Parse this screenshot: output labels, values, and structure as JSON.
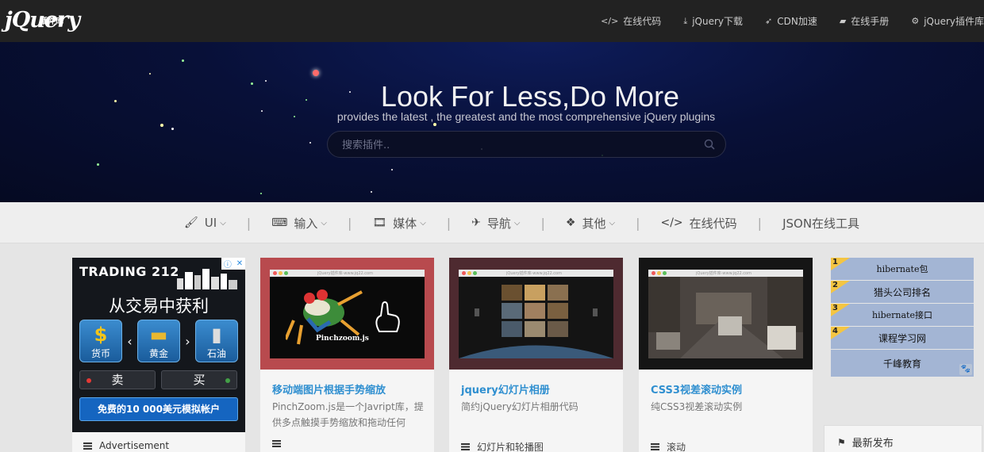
{
  "topbar": {
    "logo_text": "jQuery",
    "logo_badge": "插件库",
    "nav": [
      {
        "icon": "code-icon",
        "glyph": "</>",
        "label": "在线代码"
      },
      {
        "icon": "download-icon",
        "glyph": "⤓",
        "label": "jQuery下载"
      },
      {
        "icon": "rocket-icon",
        "glyph": "➶",
        "label": "CDN加速"
      },
      {
        "icon": "book-icon",
        "glyph": "▰",
        "label": "在线手册"
      },
      {
        "icon": "gears-icon",
        "glyph": "⚙",
        "label": "jQuery插件库"
      }
    ]
  },
  "hero": {
    "title": "Look For Less,Do More",
    "subtitle": "provides the latest , the greatest and the most comprehensive jQuery plugins",
    "search_placeholder": "搜索插件.."
  },
  "categories": [
    {
      "icon": "brush-icon",
      "glyph": "🖌",
      "label": "UI",
      "dropdown": true
    },
    {
      "icon": "keyboard-icon",
      "glyph": "⌨",
      "label": "输入",
      "dropdown": true
    },
    {
      "icon": "film-icon",
      "glyph": "🎞",
      "label": "媒体",
      "dropdown": true
    },
    {
      "icon": "paper-plane-icon",
      "glyph": "✈",
      "label": "导航",
      "dropdown": true
    },
    {
      "icon": "dropbox-icon",
      "glyph": "❖",
      "label": "其他",
      "dropdown": true
    },
    {
      "icon": "code-icon",
      "glyph": "</>",
      "label": "在线代码",
      "dropdown": false
    },
    {
      "icon": "",
      "glyph": "",
      "label": "JSON在线工具",
      "dropdown": false
    }
  ],
  "ad": {
    "brand": "TRADING 212",
    "headline": "从交易中获利",
    "assets": [
      {
        "symbol": "$",
        "label": "货币"
      },
      {
        "symbol": "▬",
        "label": "黄金"
      },
      {
        "symbol": "▮",
        "label": "石油"
      }
    ],
    "sell_label": "卖",
    "buy_label": "买",
    "cta": "免费的10 000美元模拟帐户",
    "footer_label": "Advertisement"
  },
  "cards": [
    {
      "title": "移动端图片根据手势缩放",
      "desc": "PinchZoom.js是一个Javript库，提供多点触摸手势缩放和拖动任何",
      "tag": "",
      "thumb_text": "Pinchzoom.js",
      "thumb_url": "jQuery插件库-www.jq22.com",
      "accent": "#b84a4e"
    },
    {
      "title": "jquery幻灯片相册",
      "desc": "简约jQuery幻灯片相册代码",
      "tag": "幻灯片和轮播图",
      "thumb_text": "",
      "thumb_url": "jQuery插件库-www.jq22.com",
      "accent": "#4e2a30"
    },
    {
      "title": "CSS3视差滚动实例",
      "desc": "纯CSS3视差滚动实例",
      "tag": "滚动",
      "thumb_text": "",
      "thumb_url": "jQuery插件库-www.jq22.com",
      "accent": "#151515"
    }
  ],
  "hot_list": [
    {
      "rank": "1",
      "label": "hibernate包"
    },
    {
      "rank": "2",
      "label": "猎头公司排名"
    },
    {
      "rank": "3",
      "label": "hibernate接口"
    },
    {
      "rank": "4",
      "label": "课程学习网"
    },
    {
      "rank": "",
      "label": "千峰教育"
    }
  ],
  "latest": {
    "label": "最新发布"
  },
  "colors": {
    "link_blue": "#2f8fd0",
    "topbar_bg": "#222222",
    "hot_item_bg": "#a3b5d4",
    "rank_badge": "#f4c542"
  }
}
